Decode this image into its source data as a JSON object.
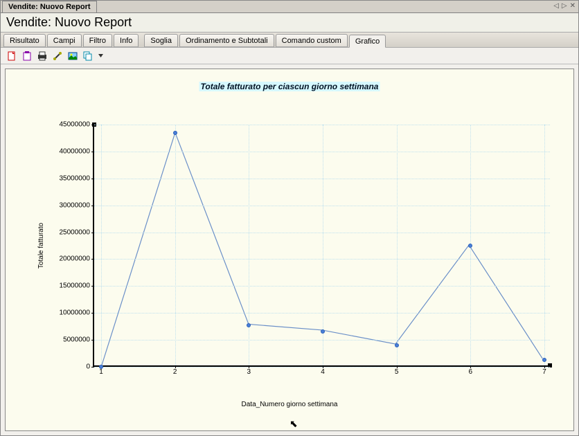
{
  "window": {
    "tab_title": "Vendite: Nuovo Report",
    "arrow_left": "◁",
    "arrow_right": "▷",
    "close": "✕"
  },
  "title": "Vendite: Nuovo Report",
  "tabs": [
    {
      "label": "Risultato"
    },
    {
      "label": "Campi"
    },
    {
      "label": "Filtro"
    },
    {
      "label": "Info"
    },
    {
      "label": "Soglia"
    },
    {
      "label": "Ordinamento e Subtotali"
    },
    {
      "label": "Comando custom"
    },
    {
      "label": "Grafico",
      "active": true
    }
  ],
  "toolbar": {
    "icons": [
      "new-file-icon",
      "clipboard-icon",
      "print-icon",
      "tools-icon",
      "image-icon",
      "copy-icon",
      "dropdown-icon"
    ]
  },
  "chart_data": {
    "type": "line",
    "title": "Totale fatturato per ciascun giorno settimana",
    "xlabel": "Data_Numero giorno settimana",
    "ylabel": "Totale fatturato",
    "x": [
      1,
      2,
      3,
      4,
      5,
      6,
      7
    ],
    "y": [
      0,
      43500000,
      7700000,
      6600000,
      4000000,
      22500000,
      1300000
    ],
    "ylim": [
      0,
      45000000
    ],
    "xlim": [
      1,
      7
    ],
    "y_ticks": [
      0,
      5000000,
      10000000,
      15000000,
      20000000,
      25000000,
      30000000,
      35000000,
      40000000,
      45000000
    ],
    "x_ticks": [
      1,
      2,
      3,
      4,
      5,
      6,
      7
    ]
  }
}
